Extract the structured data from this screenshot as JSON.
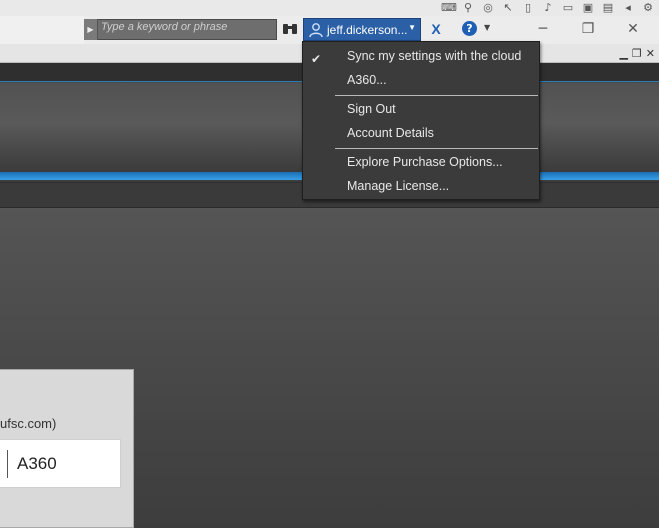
{
  "search": {
    "placeholder": "Type a keyword or phrase"
  },
  "account": {
    "username": "jeff.dickerson..."
  },
  "menu": {
    "items": [
      {
        "label": "Sync my settings with the cloud",
        "checked": true
      },
      {
        "label": "A360..."
      },
      {
        "label": "Sign Out"
      },
      {
        "label": "Account Details"
      },
      {
        "label": "Explore Purchase Options..."
      },
      {
        "label": "Manage License..."
      }
    ]
  },
  "dialog": {
    "email_fragment": "ufsc.com)",
    "field_value": "A360"
  },
  "colors": {
    "accent_blue": "#2b5fa6",
    "menu_bg": "#3b3b3b",
    "ribbon_highlight": "#38a0e8"
  },
  "icons": {
    "system_tray": [
      "keyboard-icon",
      "pin-icon",
      "globe-icon",
      "cursor-icon",
      "document-icon",
      "speaker-icon",
      "monitor-icon",
      "window-icon",
      "terminal-icon",
      "arrow-icon",
      "gear-icon"
    ]
  }
}
